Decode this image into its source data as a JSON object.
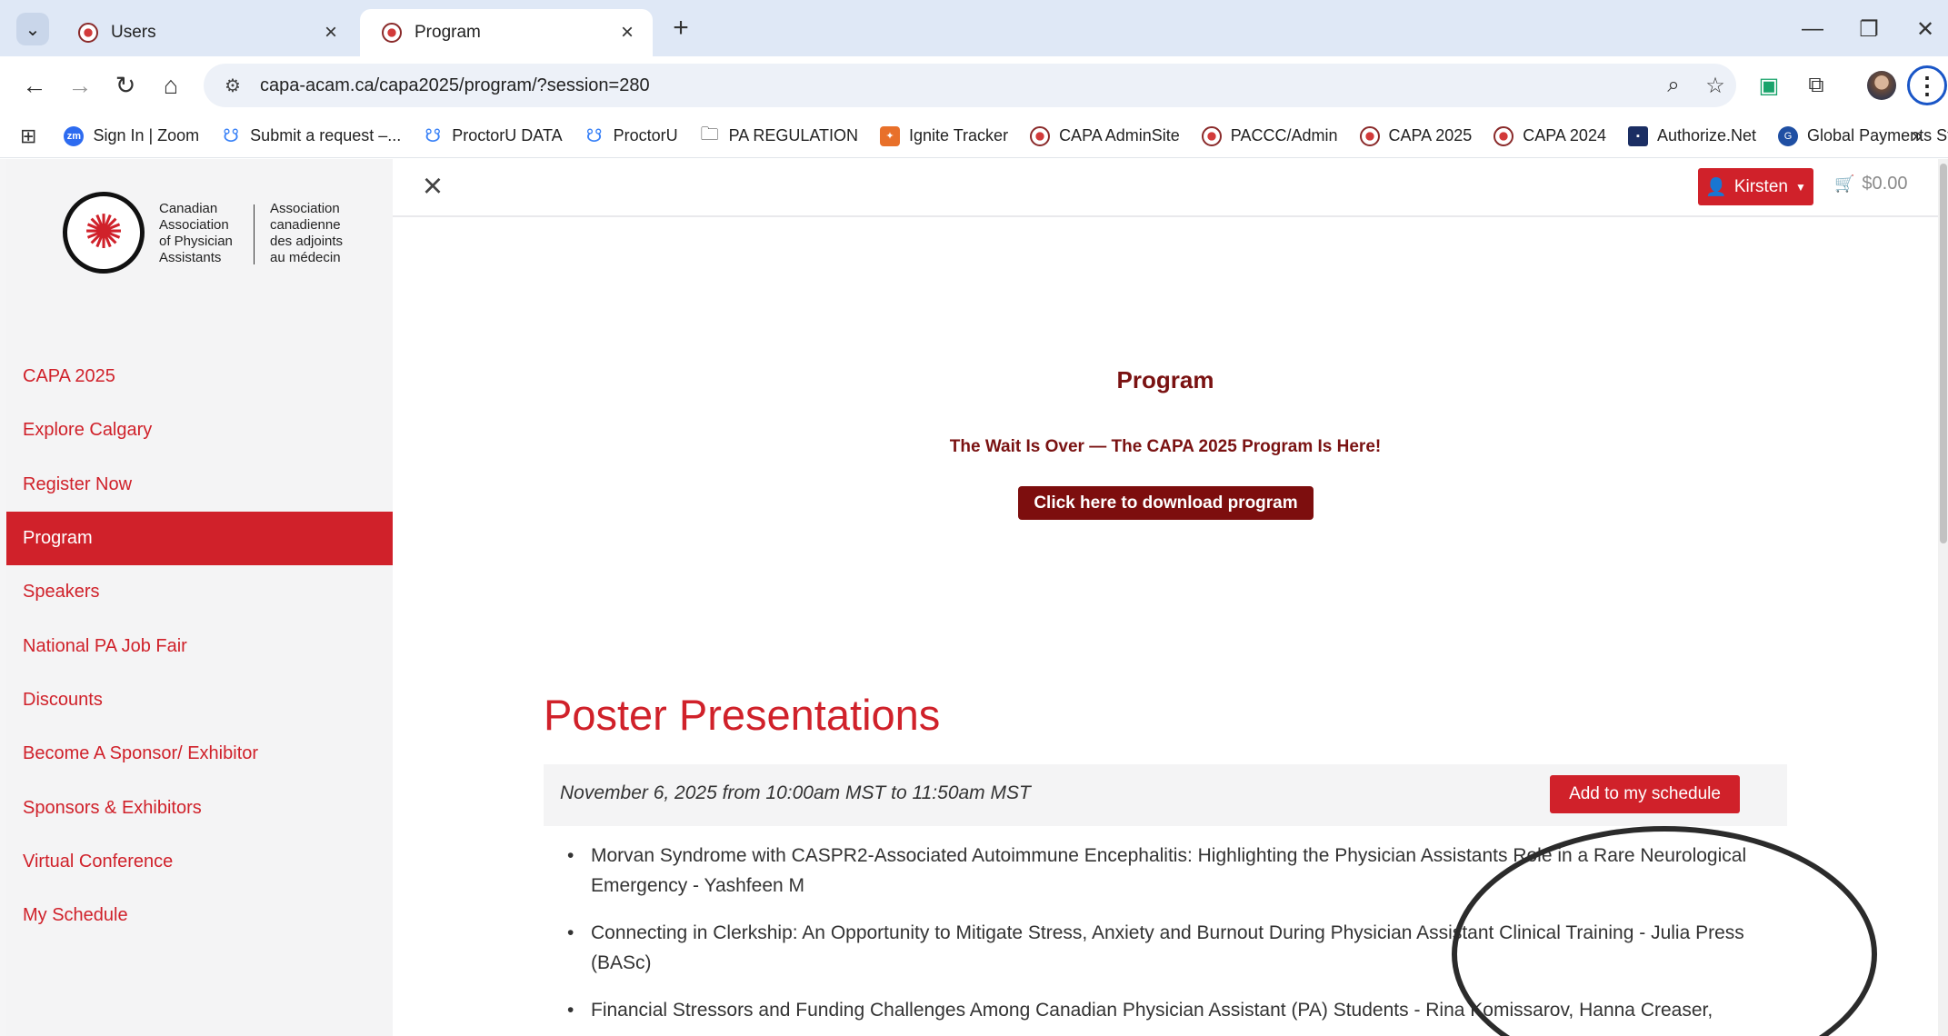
{
  "browser": {
    "tabs": [
      {
        "label": "Users"
      },
      {
        "label": "Program"
      }
    ],
    "new_tab_label": "+",
    "window_controls": {
      "minimize": "—",
      "restore": "❐",
      "close": "✕"
    },
    "url": "capa-acam.ca/capa2025/program/?session=280",
    "bookmarks": [
      {
        "label": "Sign In | Zoom",
        "icon": "zoom-icon",
        "glyph": "zm"
      },
      {
        "label": "Submit a request –...",
        "icon": "proctoru-icon",
        "glyph": "☋"
      },
      {
        "label": "ProctorU DATA",
        "icon": "proctoru-icon",
        "glyph": "☋"
      },
      {
        "label": "ProctorU",
        "icon": "proctoru-icon",
        "glyph": "☋"
      },
      {
        "label": "PA REGULATION",
        "icon": "folder-icon",
        "glyph": "🗀"
      },
      {
        "label": "Ignite Tracker",
        "icon": "ignite-icon",
        "glyph": "✦"
      },
      {
        "label": "CAPA AdminSite",
        "icon": "capa-icon",
        "glyph": ""
      },
      {
        "label": "PACCC/Admin",
        "icon": "capa-icon",
        "glyph": ""
      },
      {
        "label": "CAPA 2025",
        "icon": "capa-icon",
        "glyph": ""
      },
      {
        "label": "CAPA 2024",
        "icon": "capa-icon",
        "glyph": ""
      },
      {
        "label": "Authorize.Net",
        "icon": "authorize-icon",
        "glyph": "▪"
      },
      {
        "label": "Global Payments St...",
        "icon": "global-payments-icon",
        "glyph": "G"
      }
    ],
    "bookmarks_more": "»"
  },
  "site": {
    "logo": {
      "english": [
        "Canadian",
        "Association",
        "of Physician",
        "Assistants"
      ],
      "french": [
        "Association",
        "canadienne",
        "des adjoints",
        "au médecin"
      ]
    },
    "nav": [
      {
        "label": "CAPA 2025"
      },
      {
        "label": "Explore Calgary"
      },
      {
        "label": "Register Now"
      },
      {
        "label": "Program"
      },
      {
        "label": "Speakers"
      },
      {
        "label": "National PA Job Fair"
      },
      {
        "label": "Discounts"
      },
      {
        "label": "Become A Sponsor/ Exhibitor"
      },
      {
        "label": "Sponsors & Exhibitors"
      },
      {
        "label": "Virtual Conference"
      },
      {
        "label": "My Schedule"
      }
    ],
    "active_nav": "Program",
    "user_button": "Kirsten",
    "cart_total": "$0.00"
  },
  "content": {
    "title": "Program",
    "subtitle": "The Wait Is Over — The CAPA 2025 Program Is Here!",
    "download_label": "Click here to download program",
    "section_heading": "Poster Presentations",
    "session_time": "November 6, 2025 from 10:00am MST to 11:50am MST",
    "add_schedule_label": "Add to my schedule",
    "presentations": [
      "Morvan Syndrome with CASPR2-Associated Autoimmune Encephalitis: Highlighting the Physician Assistants Role in a Rare Neurological Emergency - Yashfeen M",
      "Connecting in Clerkship: An Opportunity to Mitigate Stress, Anxiety and Burnout During Physician Assistant Clinical Training - Julia Press (BASc)",
      "Financial Stressors and Funding Challenges Among Canadian Physician Assistant (PA) Students - Rina Komissarov, Hanna Creaser,"
    ]
  },
  "colors": {
    "brand_red": "#d0212a",
    "dark_red": "#7d0e0e",
    "heading_maroon": "#7a1212",
    "annotation": "#2b2b2b"
  }
}
